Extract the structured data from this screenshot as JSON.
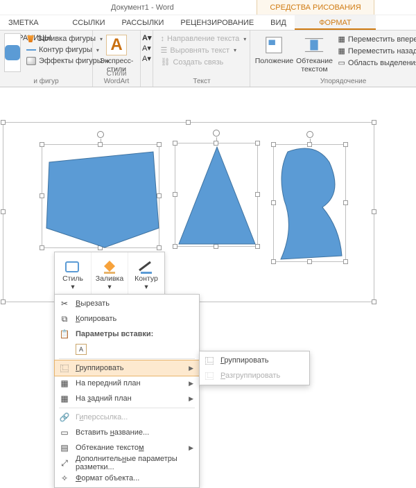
{
  "title": "Документ1 - Word",
  "tooltab": "СРЕДСТВА РИСОВАНИЯ",
  "tabs": {
    "t1": "ЗМЕТКА СТРАНИЦЫ",
    "t2": "ССЫЛКИ",
    "t3": "РАССЫЛКИ",
    "t4": "РЕЦЕНЗИРОВАНИЕ",
    "t5": "ВИД",
    "t6": "ФОРМАТ"
  },
  "ribbon": {
    "g_shapes_title": "и фигур",
    "shape_fill": "Заливка фигуры",
    "shape_outline": "Контур фигуры",
    "shape_effects": "Эффекты фигуры",
    "g_wordart_title": "Стили WordArt",
    "express_styles": "Экспресс-стили",
    "g_text_title": "Текст",
    "text_dir": "Направление текста",
    "align_text": "Выровнять текст",
    "create_link": "Создать связь",
    "g_arrange_title": "Упорядочение",
    "position": "Положение",
    "wrap": "Обтекание текстом",
    "bring_fwd": "Переместить вперед",
    "send_back": "Переместить назад",
    "selection_pane": "Область выделения"
  },
  "minitb": {
    "style": "Стиль",
    "fill": "Заливка",
    "outline": "Контур"
  },
  "menu": {
    "cut": "Вырезать",
    "copy": "Копировать",
    "paste_opts": "Параметры вставки:",
    "group": "Группировать",
    "bring_front": "На передний план",
    "send_back": "На задний план",
    "hyperlink": "Гиперссылка...",
    "caption": "Вставить название...",
    "wrap": "Обтекание текстом",
    "more_layout": "Дополнительные параметры разметки...",
    "format_obj": "Формат объекта..."
  },
  "submenu": {
    "group": "Группировать",
    "ungroup": "Разгруппировать"
  }
}
